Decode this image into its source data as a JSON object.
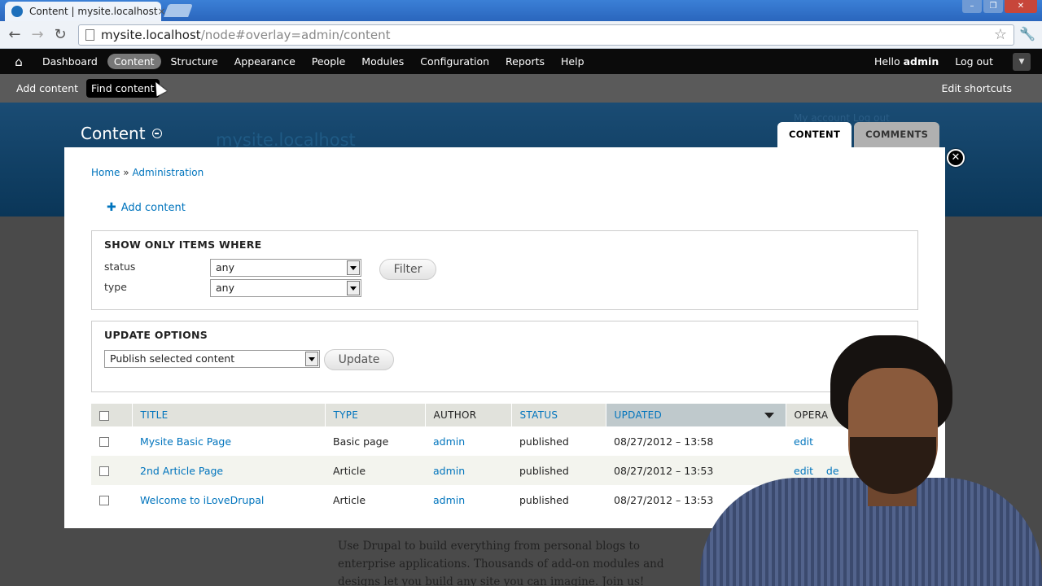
{
  "browser": {
    "tab_title": "Content | mysite.localhost",
    "tab_close": "×",
    "url_host": "mysite.localhost",
    "url_path": "/node#overlay=admin/content"
  },
  "toolbar": {
    "items": [
      "Dashboard",
      "Content",
      "Structure",
      "Appearance",
      "People",
      "Modules",
      "Configuration",
      "Reports",
      "Help"
    ],
    "active": "Content",
    "hello_prefix": "Hello ",
    "username": "admin",
    "logout": "Log out"
  },
  "shortcuts": {
    "items": [
      "Add content",
      "Find content"
    ],
    "edit": "Edit shortcuts"
  },
  "site": {
    "name": "mysite.localhost",
    "links": "My account   Log out",
    "body_text": "Use Drupal to build everything from personal blogs to enterprise applications. Thousands of add-on modules and designs let you build any site you can imagine. Join us!"
  },
  "overlay": {
    "title": "Content",
    "tabs": [
      "CONTENT",
      "COMMENTS"
    ],
    "close": "✕",
    "breadcrumb": [
      "Home",
      "Administration"
    ],
    "breadcrumb_sep": "»",
    "add_content": "Add content",
    "filter": {
      "legend": "SHOW ONLY ITEMS WHERE",
      "status_label": "status",
      "status_value": "any",
      "type_label": "type",
      "type_value": "any",
      "button": "Filter"
    },
    "update": {
      "legend": "UPDATE OPTIONS",
      "selected": "Publish selected content",
      "button": "Update"
    },
    "table": {
      "headers": [
        "TITLE",
        "TYPE",
        "AUTHOR",
        "STATUS",
        "UPDATED",
        "OPERA"
      ],
      "rows": [
        {
          "title": "Mysite Basic Page",
          "type": "Basic page",
          "author": "admin",
          "status": "published",
          "updated": "08/27/2012 – 13:58",
          "op": "edit"
        },
        {
          "title": "2nd Article Page",
          "type": "Article",
          "author": "admin",
          "status": "published",
          "updated": "08/27/2012 – 13:53",
          "op": "edit",
          "op2": "de"
        },
        {
          "title": "Welcome to iLoveDrupal",
          "type": "Article",
          "author": "admin",
          "status": "published",
          "updated": "08/27/2012 – 13:53",
          "op": ""
        }
      ]
    }
  },
  "colors": {
    "link": "#0074bd",
    "header_blue": "#0d3f66",
    "toolbar_black": "#0b0b0b"
  }
}
